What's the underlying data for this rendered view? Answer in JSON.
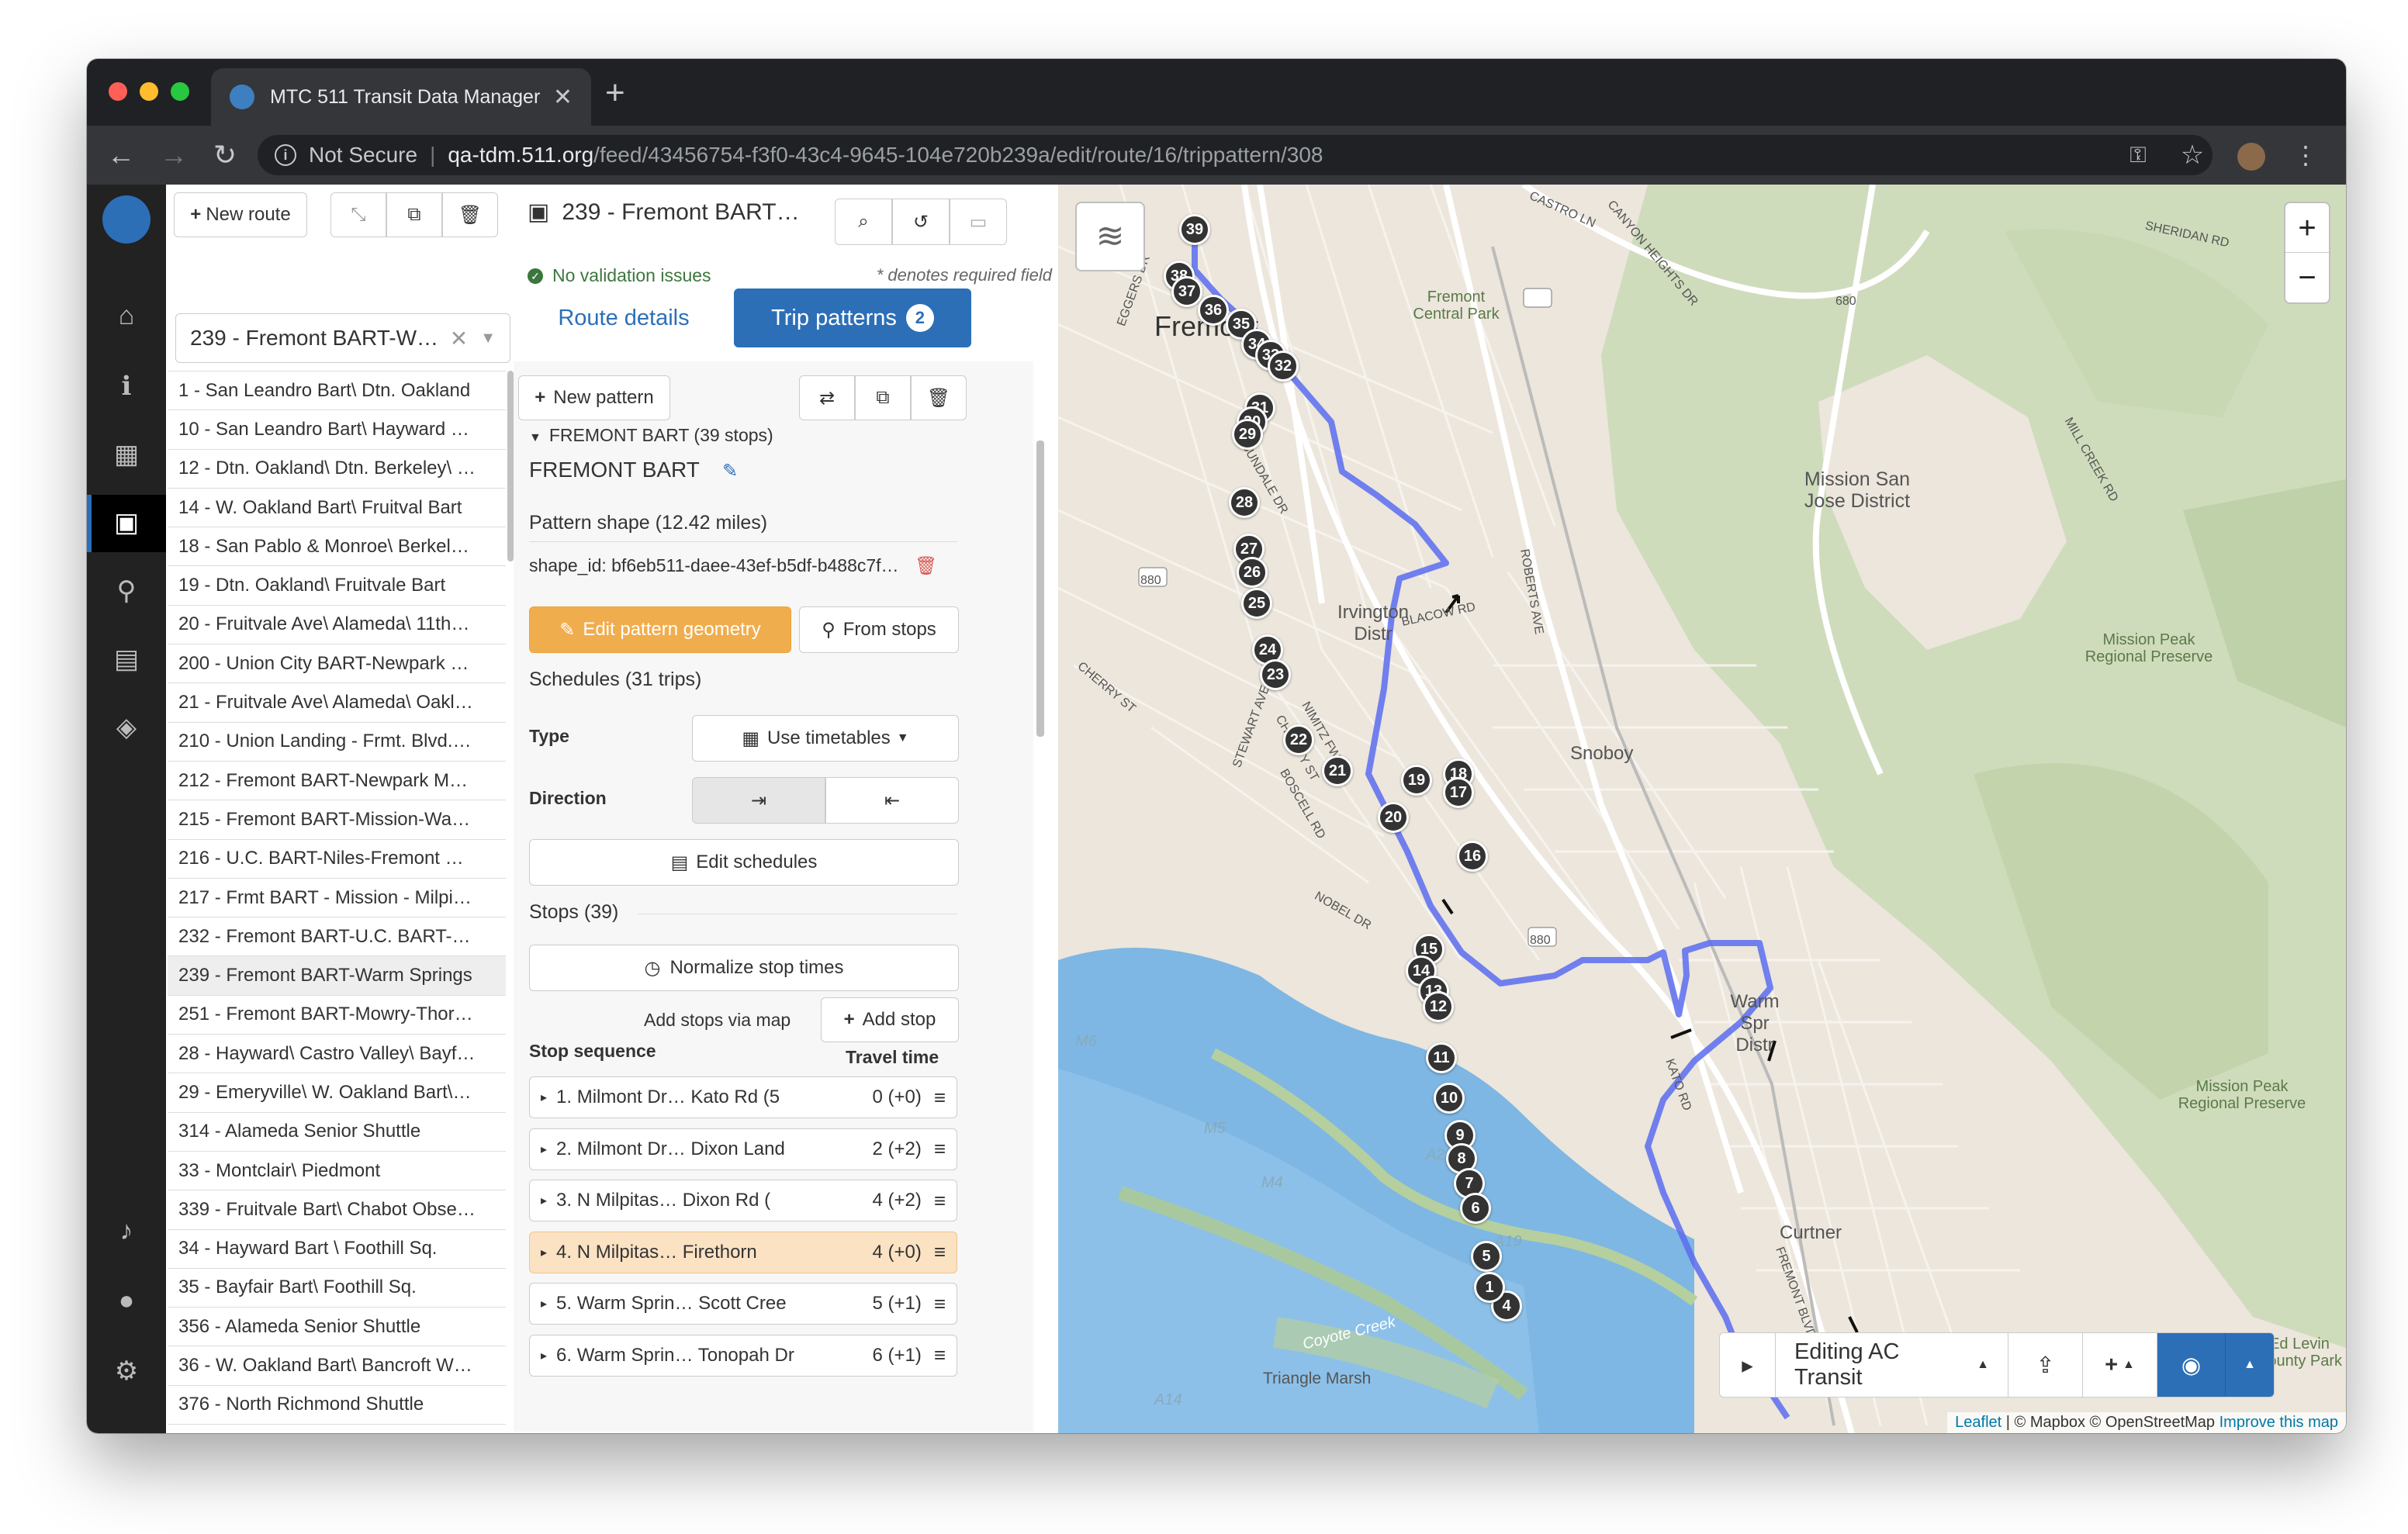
{
  "browser": {
    "tab_title": "MTC 511 Transit Data Manager",
    "url_prefix": "Not Secure",
    "url_host": "qa-tdm.511.org",
    "url_path": "/feed/43456754-f3f0-43c4-9645-104e720b239a/edit/route/16/trippattern/308"
  },
  "routes_panel": {
    "new_route_label": "New route",
    "selected_route": "239 - Fremont BART-W…",
    "items": [
      "1 - San Leandro Bart\\ Dtn. Oakland",
      "10 - San Leandro Bart\\ Hayward …",
      "12 - Dtn. Oakland\\ Dtn. Berkeley\\ …",
      "14 - W. Oakland Bart\\ Fruitval Bart",
      "18 - San Pablo & Monroe\\ Berkel…",
      "19 - Dtn. Oakland\\ Fruitvale Bart",
      "20 - Fruitvale Ave\\ Alameda\\ 11th…",
      "200 - Union City BART-Newpark …",
      "21 - Fruitvale Ave\\ Alameda\\ Oakl…",
      "210 - Union Landing - Frmt. Blvd.…",
      "212 - Fremont BART-Newpark M…",
      "215 - Fremont BART-Mission-Wa…",
      "216 - U.C. BART-Niles-Fremont …",
      "217 - Frmt BART - Mission - Milpi…",
      "232 - Fremont BART-U.C. BART-…",
      "239 - Fremont BART-Warm Springs",
      "251 - Fremont BART-Mowry-Thor…",
      "28 - Hayward\\ Castro Valley\\ Bayf…",
      "29 - Emeryville\\ W. Oakland Bart\\…",
      "314 - Alameda Senior Shuttle",
      "33 - Montclair\\ Piedmont",
      "339 - Fruitvale Bart\\ Chabot Obse…",
      "34 - Hayward Bart \\ Foothill Sq.",
      "35 - Bayfair Bart\\ Foothill Sq.",
      "356 - Alameda Senior Shuttle",
      "36 - W. Oakland Bart\\ Bancroft W…",
      "376 - North Richmond Shuttle"
    ],
    "selected_index": 15
  },
  "editor": {
    "title": "239 - Fremont BART…",
    "validation": "No validation issues",
    "required_note": "* denotes required field",
    "tab_route_details": "Route details",
    "tab_trip_patterns": "Trip patterns",
    "trip_patterns_count": "2",
    "new_pattern_label": "New pattern",
    "pattern_header": "FREMONT BART (39 stops)",
    "pattern_name": "FREMONT BART",
    "pattern_shape": "Pattern shape (12.42 miles)",
    "shape_id": "shape_id: bf6eb511-daee-43ef-b5df-b488c7f…",
    "edit_geometry_label": "Edit pattern geometry",
    "from_stops_label": "From stops",
    "schedules": "Schedules (31 trips)",
    "type_label": "Type",
    "type_value": "Use timetables",
    "direction_label": "Direction",
    "edit_schedules_label": "Edit schedules",
    "stops_heading": "Stops (39)",
    "normalize_label": "Normalize stop times",
    "add_via_map": "Add stops via map",
    "add_stop_label": "Add stop",
    "stop_sequence_label": "Stop sequence",
    "travel_time_label": "Travel time",
    "stops": [
      {
        "name": "1. Milmont Dr… Kato Rd (5",
        "time": "0 (+0)"
      },
      {
        "name": "2. Milmont Dr… Dixon Land",
        "time": "2 (+2)"
      },
      {
        "name": "3. N Milpitas… Dixon Rd (",
        "time": "4 (+2)"
      },
      {
        "name": "4. N Milpitas… Firethorn",
        "time": "4 (+0)"
      },
      {
        "name": "5. Warm Sprin… Scott Cree",
        "time": "5 (+1)"
      },
      {
        "name": "6. Warm Sprin… Tonopah Dr",
        "time": "6 (+1)"
      }
    ]
  },
  "map": {
    "editing_label": "Editing AC Transit",
    "attribution_leaflet": "Leaflet",
    "attribution_rest": "| © Mapbox © OpenStreetMap",
    "attribution_improve": "Improve this map",
    "places": {
      "fremont": "Fremont",
      "central_park": "Fremont Central Park",
      "mission_sj": "Mission San Jose District",
      "irvington": "Irvington Distr",
      "snoboy": "Snoboy",
      "warm_springs": "Warm Spr Distr",
      "curtner": "Curtner",
      "mission_peak_1": "Mission Peak Regional Preserve",
      "mission_peak_2": "Mission Peak Regional Preserve",
      "ed_levin": "Ed Levin County Park",
      "triangle_marsh": "Triangle Marsh",
      "coyote_creek": "Coyote Creek"
    },
    "roads": [
      "CASTRO LN",
      "SHERIDAN RD",
      "CANYON HEIGHTS DR",
      "EGGERS DR",
      "SUNDALE DR",
      "ROBERTS AVE",
      "BLACOW RD",
      "CHERRY ST",
      "STEWART AVE",
      "NIMITZ FWY",
      "CHRISTY ST",
      "BOSCELL RD",
      "NOBEL DR",
      "MILL CREEK RD",
      "KATO RD",
      "FREMONT BLVD"
    ],
    "highway_shields": [
      "680",
      "880",
      "880"
    ],
    "water_codes": [
      "M6",
      "M5",
      "M4",
      "A23",
      "A19",
      "A14"
    ],
    "stop_markers": [
      "39",
      "38",
      "37",
      "36",
      "35",
      "34",
      "33",
      "32",
      "31",
      "30",
      "29",
      "28",
      "27",
      "26",
      "25",
      "24",
      "23",
      "22",
      "21",
      "20",
      "19",
      "18",
      "17",
      "16",
      "15",
      "14",
      "13",
      "12",
      "11",
      "10",
      "9",
      "8",
      "7",
      "6",
      "5",
      "4",
      "1"
    ]
  }
}
